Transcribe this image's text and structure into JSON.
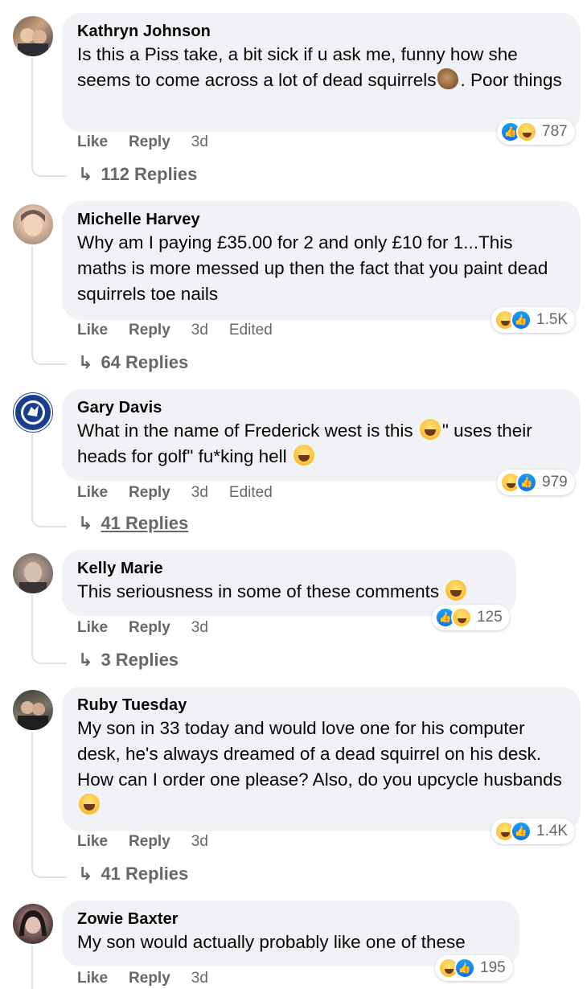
{
  "labels": {
    "like": "Like",
    "reply": "Reply",
    "edited": "Edited",
    "reply_arrow": "↳"
  },
  "colors": {
    "bubble": "#f0f2f5",
    "meta": "#65676b",
    "like_blue": "#1877f2",
    "haha_yellow": "#fcc43c"
  },
  "comments": [
    {
      "author": "Kathryn Johnson",
      "text_a": "Is this a Piss take, a bit sick if u ask me, funny how she seems to come across a lot of dead squirrels",
      "text_b": ". Poor things",
      "emoji": "squirrel-emoji",
      "reaction_icons": [
        "like",
        "haha"
      ],
      "reaction_count": "787",
      "time": "3d",
      "edited": false,
      "replies": "112 Replies"
    },
    {
      "author": "Michelle Harvey",
      "text_a": "Why am I paying £35.00 for 2 and only £10 for 1...This maths is more messed up then the fact that you paint dead squirrels toe nails",
      "reaction_icons": [
        "haha",
        "like"
      ],
      "reaction_count": "1.5K",
      "time": "3d",
      "edited": true,
      "replies": "64 Replies"
    },
    {
      "author": "Gary Davis",
      "text_a": "What in the name of Frederick west is this",
      "text_b": "\" uses their heads for golf\" fu*king hell",
      "emoji": "laughing-emoji",
      "reaction_icons": [
        "haha",
        "like"
      ],
      "reaction_count": "979",
      "time": "3d",
      "edited": true,
      "replies": "41 Replies"
    },
    {
      "author": "Kelly Marie",
      "text_a": "This seriousness in some of these comments",
      "emoji": "laughing-emoji",
      "reaction_icons": [
        "like",
        "haha"
      ],
      "reaction_count": "125",
      "time": "3d",
      "edited": false,
      "replies": "3 Replies"
    },
    {
      "author": "Ruby Tuesday",
      "text_a": "My son in 33 today and would love one for his computer desk, he's always dreamed of a dead squirrel on his desk. How can I order one please? Also, do you upcycle husbands",
      "emoji": "grinning-emoji",
      "reaction_icons": [
        "haha",
        "like"
      ],
      "reaction_count": "1.4K",
      "time": "3d",
      "edited": false,
      "replies": "41 Replies"
    },
    {
      "author": "Zowie Baxter",
      "text_a": "My son would actually probably like one of these",
      "reaction_icons": [
        "haha",
        "like"
      ],
      "reaction_count": "195",
      "time": "3d",
      "edited": false
    }
  ]
}
